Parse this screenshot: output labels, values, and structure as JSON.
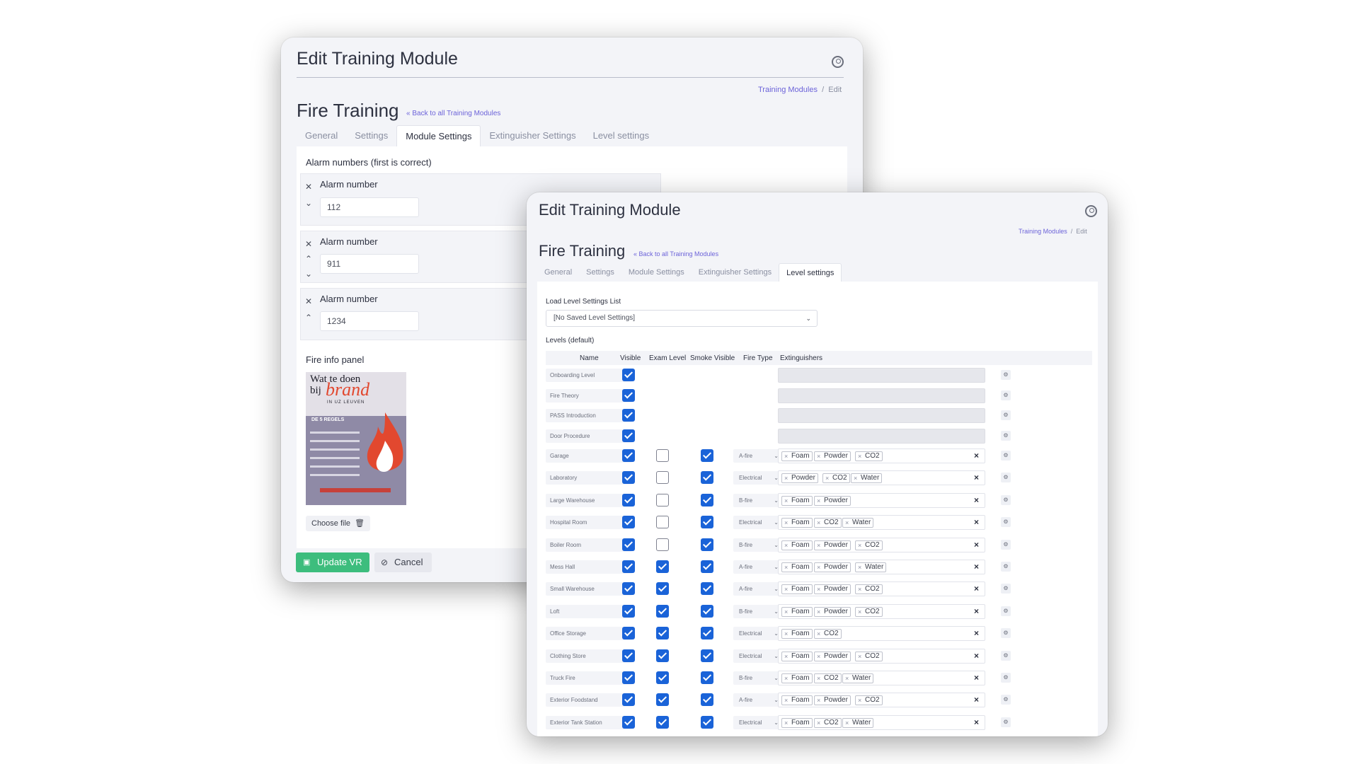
{
  "back": {
    "title": "Edit Training Module",
    "crumb_link": "Training Modules",
    "crumb_sep": "/",
    "crumb_current": "Edit",
    "heading": "Fire Training",
    "backlink": "« Back to all Training Modules",
    "tabs": [
      "General",
      "Settings",
      "Module Settings",
      "Extinguisher Settings",
      "Level settings"
    ],
    "active_tab": "Module Settings",
    "alarm_title": "Alarm numbers (first is correct)",
    "alarm_label": "Alarm number",
    "alarms": [
      "112",
      "911",
      "1234"
    ],
    "fire_info_label": "Fire info panel",
    "choose_file": "Choose file",
    "update_btn": "Update VR",
    "cancel_btn": "Cancel",
    "poster": {
      "line1": "Wat te doen",
      "line2": "bij",
      "line3": "brand",
      "line4": "IN UZ LEUVEN",
      "sub": "DE 5 REGELS"
    }
  },
  "front": {
    "title": "Edit Training Module",
    "crumb_link": "Training Modules",
    "crumb_sep": "/",
    "crumb_current": "Edit",
    "heading": "Fire Training",
    "backlink": "« Back to all Training Modules",
    "tabs": [
      "General",
      "Settings",
      "Module Settings",
      "Extinguisher Settings",
      "Level settings"
    ],
    "active_tab": "Level settings",
    "load_label": "Load Level Settings List",
    "select_value": "[No Saved Level Settings]",
    "levels_title": "Levels (default)",
    "columns": [
      "Name",
      "Visible",
      "Exam Level",
      "Smoke Visible",
      "Fire Type",
      "Extinguishers"
    ],
    "levels": [
      {
        "name": "Onboarding Level",
        "visible": true,
        "exam": null,
        "smoke": null,
        "fire_type": "",
        "ext": null
      },
      {
        "name": "Fire Theory",
        "visible": true,
        "exam": null,
        "smoke": null,
        "fire_type": "",
        "ext": null
      },
      {
        "name": "PASS Introduction",
        "visible": true,
        "exam": null,
        "smoke": null,
        "fire_type": "",
        "ext": null
      },
      {
        "name": "Door Procedure",
        "visible": true,
        "exam": null,
        "smoke": null,
        "fire_type": "",
        "ext": null
      },
      {
        "name": "Garage",
        "visible": true,
        "exam": false,
        "smoke": true,
        "fire_type": "A-fire",
        "ext": [
          "Foam",
          "Powder",
          "CO2"
        ]
      },
      {
        "name": "Laboratory",
        "visible": true,
        "exam": false,
        "smoke": true,
        "fire_type": "Electrical",
        "ext": [
          "Powder",
          "CO2",
          "Water"
        ]
      },
      {
        "name": "Large Warehouse",
        "visible": true,
        "exam": false,
        "smoke": true,
        "fire_type": "B-fire",
        "ext": [
          "Foam",
          "Powder"
        ]
      },
      {
        "name": "Hospital Room",
        "visible": true,
        "exam": false,
        "smoke": true,
        "fire_type": "Electrical",
        "ext": [
          "Foam",
          "CO2",
          "Water"
        ]
      },
      {
        "name": "Boiler Room",
        "visible": true,
        "exam": false,
        "smoke": true,
        "fire_type": "B-fire",
        "ext": [
          "Foam",
          "Powder",
          "CO2"
        ]
      },
      {
        "name": "Mess Hall",
        "visible": true,
        "exam": true,
        "smoke": true,
        "fire_type": "A-fire",
        "ext": [
          "Foam",
          "Powder",
          "Water"
        ]
      },
      {
        "name": "Small Warehouse",
        "visible": true,
        "exam": true,
        "smoke": true,
        "fire_type": "A-fire",
        "ext": [
          "Foam",
          "Powder",
          "CO2"
        ]
      },
      {
        "name": "Loft",
        "visible": true,
        "exam": true,
        "smoke": true,
        "fire_type": "B-fire",
        "ext": [
          "Foam",
          "Powder",
          "CO2"
        ]
      },
      {
        "name": "Office Storage",
        "visible": true,
        "exam": true,
        "smoke": true,
        "fire_type": "Electrical",
        "ext": [
          "Foam",
          "CO2"
        ]
      },
      {
        "name": "Clothing Store",
        "visible": true,
        "exam": true,
        "smoke": true,
        "fire_type": "Electrical",
        "ext": [
          "Foam",
          "Powder",
          "CO2"
        ]
      },
      {
        "name": "Truck Fire",
        "visible": true,
        "exam": true,
        "smoke": true,
        "fire_type": "B-fire",
        "ext": [
          "Foam",
          "CO2",
          "Water"
        ]
      },
      {
        "name": "Exterior Foodstand",
        "visible": true,
        "exam": true,
        "smoke": true,
        "fire_type": "A-fire",
        "ext": [
          "Foam",
          "Powder",
          "CO2"
        ]
      },
      {
        "name": "Exterior Tank Station",
        "visible": true,
        "exam": true,
        "smoke": true,
        "fire_type": "Electrical",
        "ext": [
          "Foam",
          "CO2",
          "Water"
        ]
      }
    ]
  },
  "colors": {
    "accent": "#6c63d9",
    "checkbox": "#1a63d8",
    "success": "#3dbd7d"
  }
}
